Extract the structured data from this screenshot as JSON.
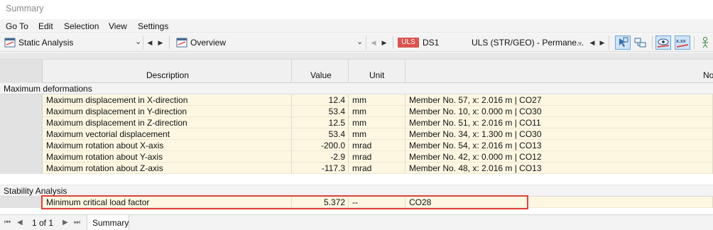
{
  "window": {
    "title": "Summary"
  },
  "menu": [
    "Go To",
    "Edit",
    "Selection",
    "View",
    "Settings"
  ],
  "toolbar": {
    "analysis_combo": "Static Analysis",
    "view_combo": "Overview",
    "design_situation_badge": "ULS",
    "design_situation": "DS1",
    "design_situation_desc": "ULS (STR/GEO) - Permane...",
    "accent_badge_color": "#d9534f"
  },
  "table": {
    "columns": {
      "description": "Description",
      "value": "Value",
      "unit": "Unit",
      "note": "No"
    },
    "groups": [
      {
        "title": "Maximum deformations",
        "rows": [
          {
            "description": "Maximum displacement in X-direction",
            "value": "12.4",
            "unit": "mm",
            "note": "Member No. 57, x: 2.016 m | CO27"
          },
          {
            "description": "Maximum displacement in Y-direction",
            "value": "53.4",
            "unit": "mm",
            "note": "Member No. 10, x: 0.000 m | CO30"
          },
          {
            "description": "Maximum displacement in Z-direction",
            "value": "12.5",
            "unit": "mm",
            "note": "Member No. 51, x: 2.016 m | CO11"
          },
          {
            "description": "Maximum vectorial displacement",
            "value": "53.4",
            "unit": "mm",
            "note": "Member No. 34, x: 1.300 m | CO30"
          },
          {
            "description": "Maximum rotation about X-axis",
            "value": "-200.0",
            "unit": "mrad",
            "note": "Member No. 54, x: 2.016 m | CO13"
          },
          {
            "description": "Maximum rotation about Y-axis",
            "value": "-2.9",
            "unit": "mrad",
            "note": "Member No. 42, x: 0.000 m | CO12"
          },
          {
            "description": "Maximum rotation about Z-axis",
            "value": "-117.3",
            "unit": "mrad",
            "note": "Member No. 48, x: 2.016 m | CO13"
          }
        ]
      },
      {
        "title": "Stability Analysis",
        "rows": [
          {
            "description": "Minimum critical load factor",
            "value": "5.372",
            "unit": "--",
            "note": "CO28"
          }
        ]
      }
    ]
  },
  "status": {
    "page": "1 of 1",
    "tab": "Summary"
  }
}
